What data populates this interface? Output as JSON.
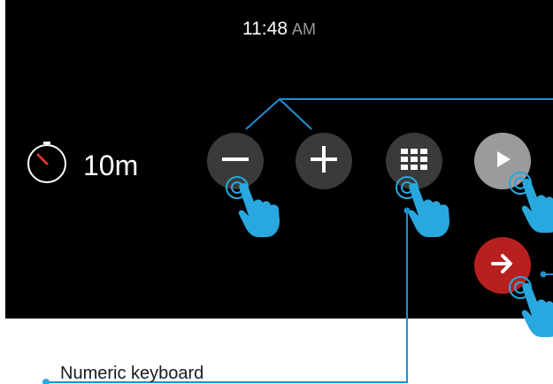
{
  "clock": {
    "time": "11:48",
    "ampm": "AM"
  },
  "timer": {
    "value": "10m",
    "icon": "stopwatch-icon"
  },
  "controls": {
    "minus": {
      "icon": "minus-icon"
    },
    "plus": {
      "icon": "plus-icon"
    },
    "keyboard": {
      "icon": "grid-keypad-icon"
    },
    "play": {
      "icon": "play-icon"
    },
    "next": {
      "icon": "arrow-right-icon"
    }
  },
  "callouts": {
    "numeric_keyboard": "Numeric keyboard"
  },
  "colors": {
    "accent_blue": "#29a8e0",
    "line_blue": "#1e8fd6",
    "red": "#b81f1f",
    "dark_button": "#3a3a3a",
    "gray_button": "#9b9b9b"
  }
}
